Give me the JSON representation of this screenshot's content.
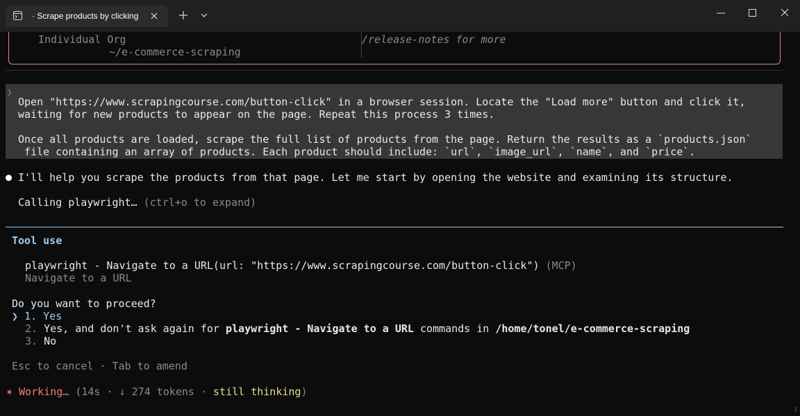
{
  "window": {
    "tab_title": "· Scrape products by clicking"
  },
  "welcome": {
    "org": "Individual Org",
    "path": "~/e-commerce-scraping",
    "release_hint": "/release-notes for more"
  },
  "prompt": {
    "line1": "Open \"https://www.scrapingcourse.com/button-click\" in a browser session. Locate the \"Load more\" button and click it,",
    "line2": "waiting for new products to appear on the page. Repeat this process 3 times.",
    "line3": "Once all products are loaded, scrape the full list of products from the page. Return the results as a `products.json`",
    "line4": " file containing an array of products. Each product should include: `url`, `image_url`, `name`, and `price`."
  },
  "assistant": {
    "message": "I'll help you scrape the products from that page. Let me start by opening the website and examining its structure.",
    "calling": "Calling playwright…",
    "calling_hint": "(ctrl+o to expand)"
  },
  "tool": {
    "header": "Tool use",
    "call": "playwright - Navigate to a URL(url: \"https://www.scrapingcourse.com/button-click\")",
    "mcp": "(MCP)",
    "description": "Navigate to a URL",
    "question": "Do you want to proceed?",
    "selector": "❯",
    "options": [
      {
        "number": "1.",
        "label": "Yes"
      },
      {
        "number": "2.",
        "label_a": "Yes, and don't ask again for",
        "label_b": "playwright - Navigate to a URL",
        "label_c": "commands in",
        "label_d": "/home/tonel/e-commerce-scraping"
      },
      {
        "number": "3.",
        "label": "No"
      }
    ],
    "footer": "Esc to cancel · Tab to amend"
  },
  "status": {
    "spinner": "✶",
    "working": "Working…",
    "open": "(14s · ↓ 274 tokens ·",
    "thinking": "still thinking",
    "close": ")"
  },
  "colors": {
    "accent_orange": "#e8856d",
    "tool_blue": "#9ecbf0",
    "thinking_yellow": "#e3dc8c",
    "box_border": "#d9877a"
  }
}
